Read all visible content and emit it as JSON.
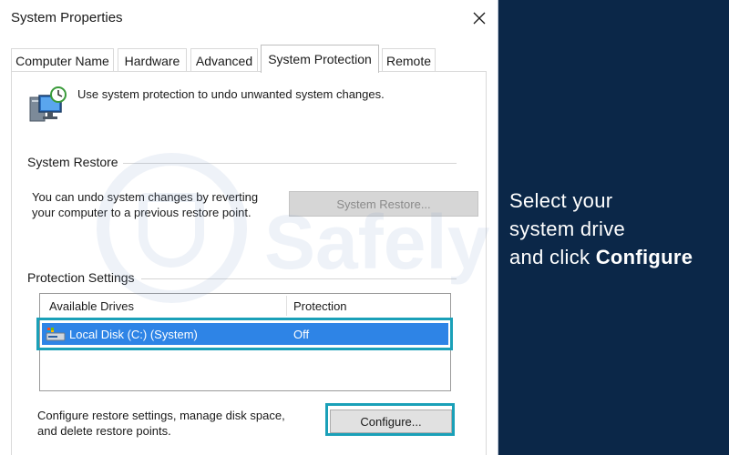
{
  "window": {
    "title": "System Properties",
    "close_icon": "close-icon"
  },
  "tabs": [
    {
      "label": "Computer Name",
      "active": false
    },
    {
      "label": "Hardware",
      "active": false
    },
    {
      "label": "Advanced",
      "active": false
    },
    {
      "label": "System Protection",
      "active": true
    },
    {
      "label": "Remote",
      "active": false
    }
  ],
  "intro": {
    "icon": "system-protection-icon",
    "text": "Use system protection to undo unwanted system changes."
  },
  "system_restore": {
    "group_label": "System Restore",
    "description_line1": "You can undo system changes by reverting",
    "description_line2": "your computer to a previous restore point.",
    "button_label": "System Restore...",
    "button_enabled": false
  },
  "protection_settings": {
    "group_label": "Protection Settings",
    "columns": [
      "Available Drives",
      "Protection"
    ],
    "drives": [
      {
        "name": "Local Disk (C:) (System)",
        "protection": "Off",
        "selected": true,
        "icon": "drive-icon"
      }
    ],
    "config_text_line1": "Configure restore settings, manage disk space,",
    "config_text_line2": "and delete restore points.",
    "configure_label": "Configure..."
  },
  "overlay": {
    "watermark": "Safely",
    "instruction_line1": "Select your",
    "instruction_line2": "system drive",
    "instruction_line3_prefix": "and click ",
    "instruction_line3_bold": "Configure"
  },
  "colors": {
    "background": "#0b2748",
    "selection": "#2e84e6",
    "highlight": "#1aa0b8"
  }
}
